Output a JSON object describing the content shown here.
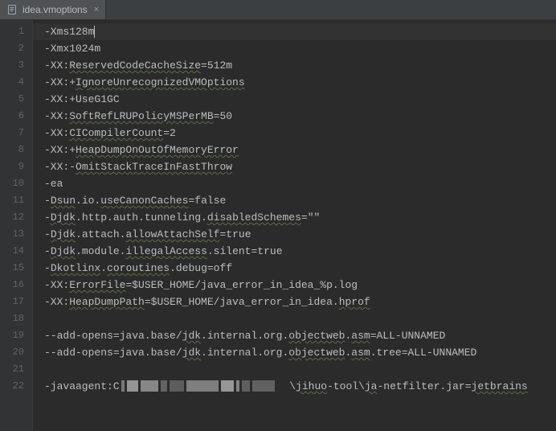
{
  "tab": {
    "filename": "idea.vmoptions",
    "close_glyph": "×"
  },
  "lines": [
    {
      "n": 1,
      "plain": "-Xms128m",
      "caret": true
    },
    {
      "n": 2,
      "plain": "-Xmx1024m"
    },
    {
      "n": 3,
      "segs": [
        [
          "-XX:",
          false
        ],
        [
          "ReservedCodeCacheSize",
          true
        ],
        [
          "=512m",
          false
        ]
      ]
    },
    {
      "n": 4,
      "segs": [
        [
          "-XX:+",
          false
        ],
        [
          "IgnoreUnrecognizedVMOptions",
          true
        ]
      ]
    },
    {
      "n": 5,
      "plain": "-XX:+UseG1GC"
    },
    {
      "n": 6,
      "segs": [
        [
          "-XX:",
          false
        ],
        [
          "SoftRefLRUPolicyMSPerMB",
          true
        ],
        [
          "=50",
          false
        ]
      ]
    },
    {
      "n": 7,
      "segs": [
        [
          "-XX:",
          false
        ],
        [
          "CICompilerCount",
          true
        ],
        [
          "=2",
          false
        ]
      ]
    },
    {
      "n": 8,
      "segs": [
        [
          "-XX:+",
          false
        ],
        [
          "HeapDumpOnOutOfMemoryError",
          true
        ]
      ]
    },
    {
      "n": 9,
      "segs": [
        [
          "-XX:-",
          false
        ],
        [
          "OmitStackTraceInFastThrow",
          true
        ]
      ]
    },
    {
      "n": 10,
      "plain": "-ea"
    },
    {
      "n": 11,
      "segs": [
        [
          "-",
          false
        ],
        [
          "Dsun",
          true
        ],
        [
          ".io.",
          false
        ],
        [
          "useCanonCaches",
          true
        ],
        [
          "=false",
          false
        ]
      ]
    },
    {
      "n": 12,
      "segs": [
        [
          "-",
          false
        ],
        [
          "Djdk",
          true
        ],
        [
          ".http.auth.tunneling.",
          false
        ],
        [
          "disabledSchemes",
          true
        ],
        [
          "=\"\"",
          false
        ]
      ]
    },
    {
      "n": 13,
      "segs": [
        [
          "-",
          false
        ],
        [
          "Djdk",
          true
        ],
        [
          ".attach.",
          false
        ],
        [
          "allowAttachSelf",
          true
        ],
        [
          "=true",
          false
        ]
      ]
    },
    {
      "n": 14,
      "segs": [
        [
          "-",
          false
        ],
        [
          "Djdk",
          true
        ],
        [
          ".module.",
          false
        ],
        [
          "illegalAccess",
          true
        ],
        [
          ".silent=true",
          false
        ]
      ]
    },
    {
      "n": 15,
      "segs": [
        [
          "-",
          false
        ],
        [
          "Dkotlinx",
          true
        ],
        [
          ".",
          false
        ],
        [
          "coroutines",
          true
        ],
        [
          ".debug=off",
          false
        ]
      ]
    },
    {
      "n": 16,
      "segs": [
        [
          "-XX:",
          false
        ],
        [
          "ErrorFile",
          true
        ],
        [
          "=$USER_HOME/java_error_in_idea_%p.log",
          false
        ]
      ]
    },
    {
      "n": 17,
      "segs": [
        [
          "-XX:",
          false
        ],
        [
          "HeapDumpPath",
          true
        ],
        [
          "=$USER_HOME/java_error_in_idea.",
          false
        ],
        [
          "hprof",
          true
        ]
      ]
    },
    {
      "n": 18,
      "plain": ""
    },
    {
      "n": 19,
      "segs": [
        [
          "--add-opens=java.base/",
          false
        ],
        [
          "jdk",
          true
        ],
        [
          ".internal.org.",
          false
        ],
        [
          "objectweb",
          true
        ],
        [
          ".",
          false
        ],
        [
          "asm",
          true
        ],
        [
          "=ALL-UNNAMED",
          false
        ]
      ]
    },
    {
      "n": 20,
      "segs": [
        [
          "--add-opens=java.base/",
          false
        ],
        [
          "jdk",
          true
        ],
        [
          ".internal.org.",
          false
        ],
        [
          "objectweb",
          true
        ],
        [
          ".",
          false
        ],
        [
          "asm",
          true
        ],
        [
          ".tree=ALL-UNNAMED",
          false
        ]
      ]
    },
    {
      "n": 21,
      "plain": ""
    },
    {
      "n": 22,
      "redacted": true,
      "pre": "-javaagent:C",
      "post_segs": [
        [
          "\\",
          false
        ],
        [
          "jihuo",
          true
        ],
        [
          "-tool\\",
          false
        ],
        [
          "ja",
          true
        ],
        [
          "-netfilter.jar=",
          false
        ],
        [
          "jetbrains",
          true
        ]
      ]
    }
  ]
}
